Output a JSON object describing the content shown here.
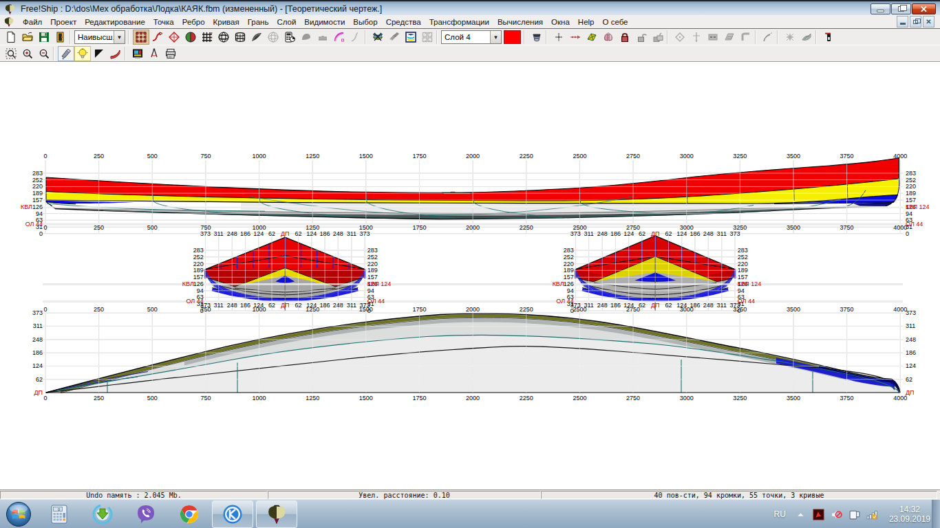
{
  "window": {
    "title": "Free!Ship  : D:\\dos\\Мех обработка\\Лодка\\КАЯК.fbm (измененный) - [Теоретический чертеж.]"
  },
  "menu": {
    "items": [
      "Файл",
      "Проект",
      "Редактирование",
      "Точка",
      "Ребро",
      "Кривая",
      "Грань",
      "Слой",
      "Видимости",
      "Выбор",
      "Средства",
      "Трансформации",
      "Вычисления",
      "Окна",
      "Help",
      "О себе"
    ]
  },
  "toolbar": {
    "precision_combo_value": "Наивысш.",
    "layer_combo_value": "Слой 4",
    "layer_color": "#ff0000",
    "row1_groups": [
      [
        "new-file",
        "open-file",
        "save-file",
        "exit-program"
      ],
      [
        "COMBO_PRECISION"
      ],
      [
        "show-control-net:tan",
        "edit-curve",
        "developable-check",
        "interior-edges",
        "intersection-grid",
        "wireframe-view",
        "stations-view",
        "shaded-view",
        "gauss-curvature",
        "hydrostatics-calc",
        "solid-gray",
        "keel-rudder",
        "curvature-plot",
        "normals-view"
      ],
      [
        "intersections",
        "develop-plates",
        "layer-properties",
        "split-grid"
      ],
      [
        "COMBO_LAYER",
        "SWATCH"
      ],
      [
        "perspective-view"
      ],
      [
        "move-point",
        "insert-point",
        "new-face",
        "mirror-face",
        "lock-points",
        "unlock-points",
        "lock-all-points"
      ],
      [
        "project-points",
        "align-points",
        "collapse-edge",
        "insert-plane",
        "intersect-layers"
      ],
      [
        "new-curve"
      ],
      [
        "remove-unused",
        "develop-surface"
      ],
      [
        "remote-control"
      ]
    ],
    "row2_groups": [
      [
        "zoom-area",
        "zoom-in",
        "zoom-out"
      ],
      [
        "wide-brush:sel",
        "lamp:yellow",
        "flag",
        "ribbon-curve"
      ],
      [
        "import-image",
        "plumb-compass",
        "print"
      ]
    ]
  },
  "statusbar": {
    "panels": [
      "Undo память : 2.045 Mb.",
      "Увел. расстояние: 0.10",
      "40 пов-сти, 94 кромки, 55 точки, 3 кривые"
    ]
  },
  "taskbar": {
    "apps": [
      "calculator",
      "download-manager",
      "viber",
      "chrome"
    ],
    "open_apps": [
      "kompas",
      "freeship"
    ],
    "tray": {
      "language": "RU",
      "time": "14:32",
      "date": "23.09.2019"
    }
  },
  "drawing": {
    "x_ticks": [
      0,
      250,
      500,
      750,
      1000,
      1250,
      1500,
      1750,
      2000,
      2250,
      2500,
      2750,
      3000,
      3250,
      3500,
      3750,
      4000
    ],
    "heights": [
      0,
      31,
      63,
      94,
      126,
      157,
      189,
      220,
      252,
      283
    ],
    "half_ticks": [
      373,
      311,
      248,
      186,
      124,
      62
    ],
    "plan_ticks": [
      62,
      124,
      186,
      248,
      311,
      373
    ],
    "labels": {
      "centerline": "ДП",
      "waterline_prefix": "КВЛ",
      "waterline_left": "126",
      "waterline_right": "КВЛ 124",
      "baseline": "ОЛ 44"
    }
  }
}
